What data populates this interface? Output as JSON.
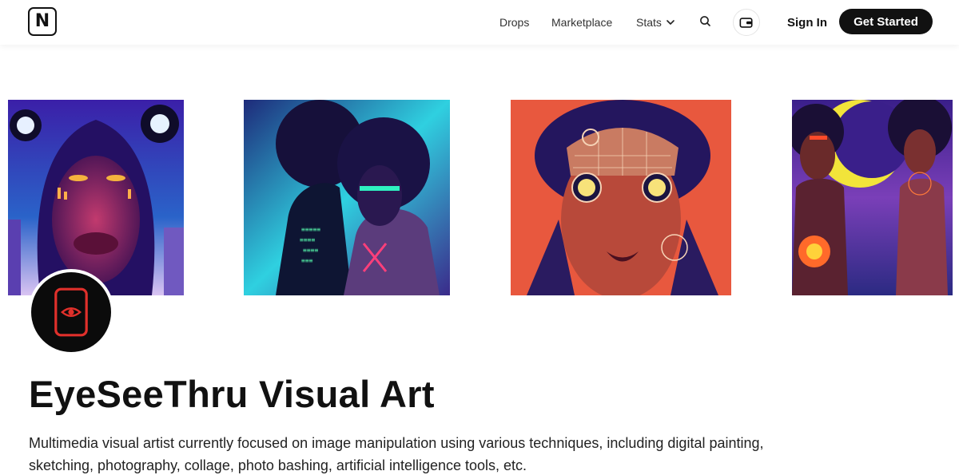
{
  "header": {
    "logo_letter": "N",
    "nav": {
      "drops": "Drops",
      "marketplace": "Marketplace",
      "stats": "Stats"
    },
    "icons": {
      "search": "search-icon",
      "wallet": "wallet-icon",
      "stats_dropdown": "chevron-down-icon"
    },
    "sign_in": "Sign In",
    "get_started": "Get Started"
  },
  "artworks": [
    "hooded-figure-neon-portrait",
    "two-figures-afro-code-portrait",
    "cyber-face-orange-portrait",
    "two-women-glowing-moon-portrait"
  ],
  "profile": {
    "avatar_icon": "eye-phone-icon",
    "name": "EyeSeeThru Visual Art",
    "bio": "Multimedia visual artist currently focused on image manipulation using various techniques, including digital painting, sketching, photography, collage, photo bashing, artificial intelligence tools, etc."
  },
  "colors": {
    "accent_button": "#111111",
    "avatar_icon": "#e0302b"
  }
}
